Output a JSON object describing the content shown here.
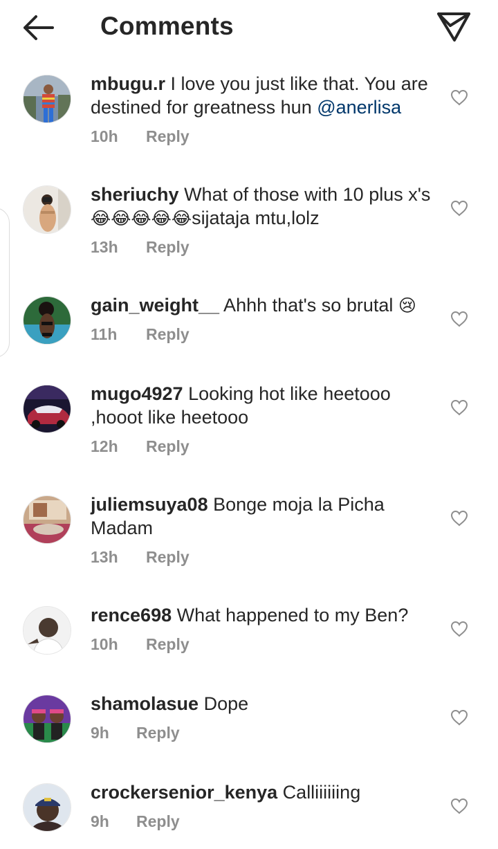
{
  "header": {
    "title": "Comments"
  },
  "comments": [
    {
      "username": "mbugu.r",
      "text": " I love you just like that. You are destined for greatness hun ",
      "mention": "@anerlisa",
      "time": "10h",
      "reply": "Reply"
    },
    {
      "username": "sheriuchy",
      "text": " What of those with 10 plus x's ",
      "emoji": "😂😂😂😂😂",
      "text2": "sijataja mtu,lolz",
      "time": "13h",
      "reply": "Reply"
    },
    {
      "username": "gain_weight__",
      "text": " Ahhh that's so brutal ",
      "emoji": "😢",
      "time": "11h",
      "reply": "Reply"
    },
    {
      "username": "mugo4927",
      "text": " Looking hot like heetooo ,hooot like heetooo",
      "time": "12h",
      "reply": "Reply"
    },
    {
      "username": "juliemsuya08",
      "text": " Bonge moja la Picha Madam",
      "time": "13h",
      "reply": "Reply"
    },
    {
      "username": "rence698",
      "text": " What happened to my Ben?",
      "time": "10h",
      "reply": "Reply"
    },
    {
      "username": "shamolasue",
      "text": " Dope",
      "time": "9h",
      "reply": "Reply"
    },
    {
      "username": "crockersenior_kenya",
      "text": " Calliiiiiing",
      "time": "9h",
      "reply": "Reply"
    }
  ],
  "icons": {
    "back": "arrow-left-icon",
    "share": "paper-plane-icon",
    "like": "heart-outline-icon"
  },
  "colors": {
    "text": "#262626",
    "secondary": "#8e8e8e",
    "mention": "#00376b",
    "background": "#ffffff"
  }
}
